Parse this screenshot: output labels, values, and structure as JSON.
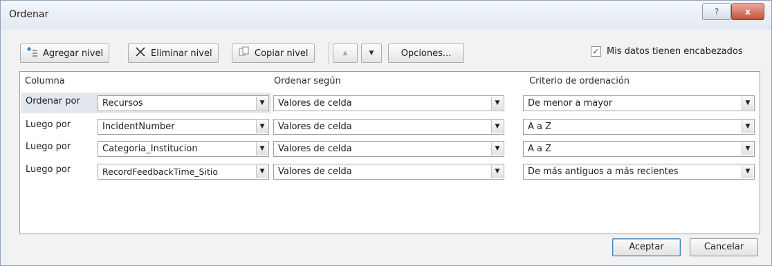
{
  "window": {
    "title": "Ordenar",
    "help_icon": "?",
    "close_icon": "x"
  },
  "toolbar": {
    "add_level": "Agregar nivel",
    "delete_level": "Eliminar nivel",
    "copy_level": "Copiar nivel",
    "move_up_icon": "▲",
    "move_down_icon": "▼",
    "options": "Opciones...",
    "has_headers_label": "Mis datos tienen encabezados",
    "has_headers_checked": true,
    "check_mark": "✓"
  },
  "grid": {
    "headers": {
      "column": "Columna",
      "sort_on": "Ordenar según",
      "order": "Criterio de ordenación"
    },
    "rows": [
      {
        "label": "Ordenar por",
        "column": "Recursos",
        "sort_on": "Valores de celda",
        "order": "De menor a mayor"
      },
      {
        "label": "Luego por",
        "column": "IncidentNumber",
        "sort_on": "Valores de celda",
        "order": "A a Z"
      },
      {
        "label": "Luego por",
        "column": "Categoria_Institucion",
        "sort_on": "Valores de celda",
        "order": "A a Z"
      },
      {
        "label": "Luego por",
        "column": "RecordFeedbackTime_Sitio",
        "sort_on": "Valores de celda",
        "order": "De más antiguos a más recientes"
      }
    ]
  },
  "footer": {
    "accept": "Aceptar",
    "cancel": "Cancelar"
  },
  "colors": {
    "selected_row": "#e3e8ee",
    "default_button_border": "#3c7fb1",
    "close_button": "#c7503d"
  }
}
